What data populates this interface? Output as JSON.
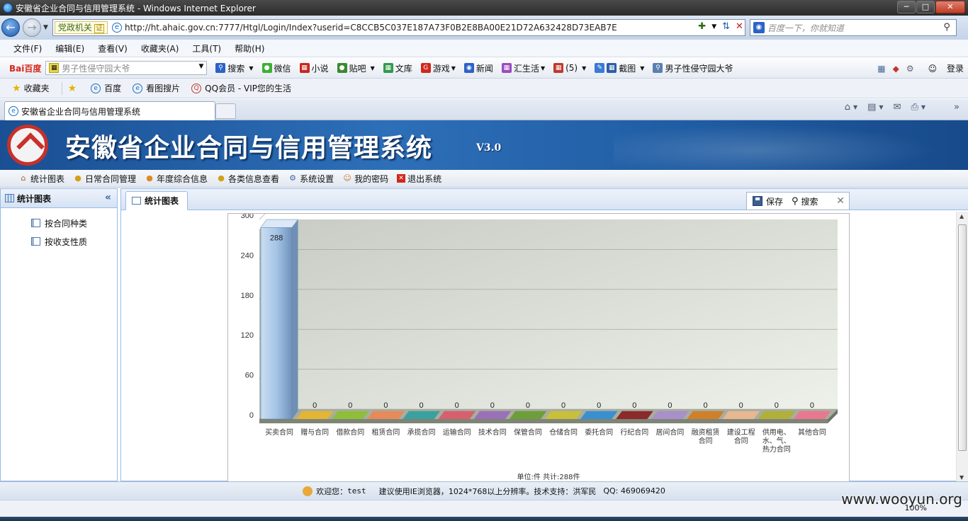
{
  "window": {
    "title": "安徽省企业合同与信用管理系统 - Windows Internet Explorer",
    "controls": [
      "─",
      "□",
      "✕"
    ]
  },
  "address": {
    "zone_label": "党政机关",
    "cert_label": "证",
    "url": "http://ht.ahaic.gov.cn:7777/Htgl/Login/Index?userid=C8CCB5C037E187A73F0B2E8BA00E21D72A632428D73EAB7E",
    "search_placeholder": "百度一下，你就知道"
  },
  "menubar": {
    "items": [
      "文件(F)",
      "编辑(E)",
      "查看(V)",
      "收藏夹(A)",
      "工具(T)",
      "帮助(H)"
    ]
  },
  "baidubar": {
    "logo": "Bai百度",
    "search_value": "男子性侵守园大爷",
    "search_btn": "搜索",
    "items": [
      "微信",
      "小说",
      "贴吧",
      "文库",
      "游戏",
      "新闻",
      "汇生活",
      "(5)",
      "截图",
      "男子性侵守园大爷"
    ],
    "login": "登录"
  },
  "favbar": {
    "favorites": "收藏夹",
    "items": [
      "百度",
      "看图搜片",
      "QQ会员 - VIP您的生活"
    ]
  },
  "tab": {
    "title": "安徽省企业合同与信用管理系统"
  },
  "app": {
    "title": "安徽省企业合同与信用管理系统",
    "version": "V3.0",
    "nav": [
      "统计图表",
      "日常合同管理",
      "年度综合信息",
      "各类信息查看",
      "系统设置",
      "我的密码",
      "退出系统"
    ],
    "left_panel": {
      "title": "统计图表",
      "items": [
        "按合同种类",
        "按收支性质"
      ]
    },
    "main_tab": "统计图表",
    "toolbar": {
      "save": "保存",
      "search": "搜索"
    },
    "footer": {
      "welcome_label": "欢迎您：",
      "user": "test",
      "notice": "建议使用IE浏览器，1024*768以上分辨率。技术支持：洪军民",
      "qq": "QQ: 469069420"
    }
  },
  "status": {
    "zoom": "100%"
  },
  "watermark": "www.wooyun.org",
  "colors": {
    "banner": "#1f5ca5",
    "accent": "#99bbe8"
  },
  "chart_data": {
    "type": "bar",
    "ylim": [
      0,
      300
    ],
    "yticks": [
      0,
      60,
      120,
      180,
      240,
      300
    ],
    "categories": [
      "买卖合同",
      "赠与合同",
      "借款合同",
      "租赁合同",
      "承揽合同",
      "运输合同",
      "技术合同",
      "保管合同",
      "仓储合同",
      "委托合同",
      "行纪合同",
      "居间合同",
      "融资租赁合同",
      "建设工程合同",
      "供用电、水、气、热力合同",
      "其他合同"
    ],
    "values": [
      288,
      0,
      0,
      0,
      0,
      0,
      0,
      0,
      0,
      0,
      0,
      0,
      0,
      0,
      0,
      0
    ],
    "colors": [
      "#8fb3d9",
      "#e3b534",
      "#8fbe3a",
      "#e68a5a",
      "#3aa0a0",
      "#d6606e",
      "#9a70b8",
      "#6e9e3a",
      "#c8c03a",
      "#3a8fd0",
      "#8a2a2a",
      "#a990c8",
      "#d0802a",
      "#e8b890",
      "#b0b03a",
      "#e87890"
    ],
    "footer_label": "单位:件 共计:288件"
  }
}
